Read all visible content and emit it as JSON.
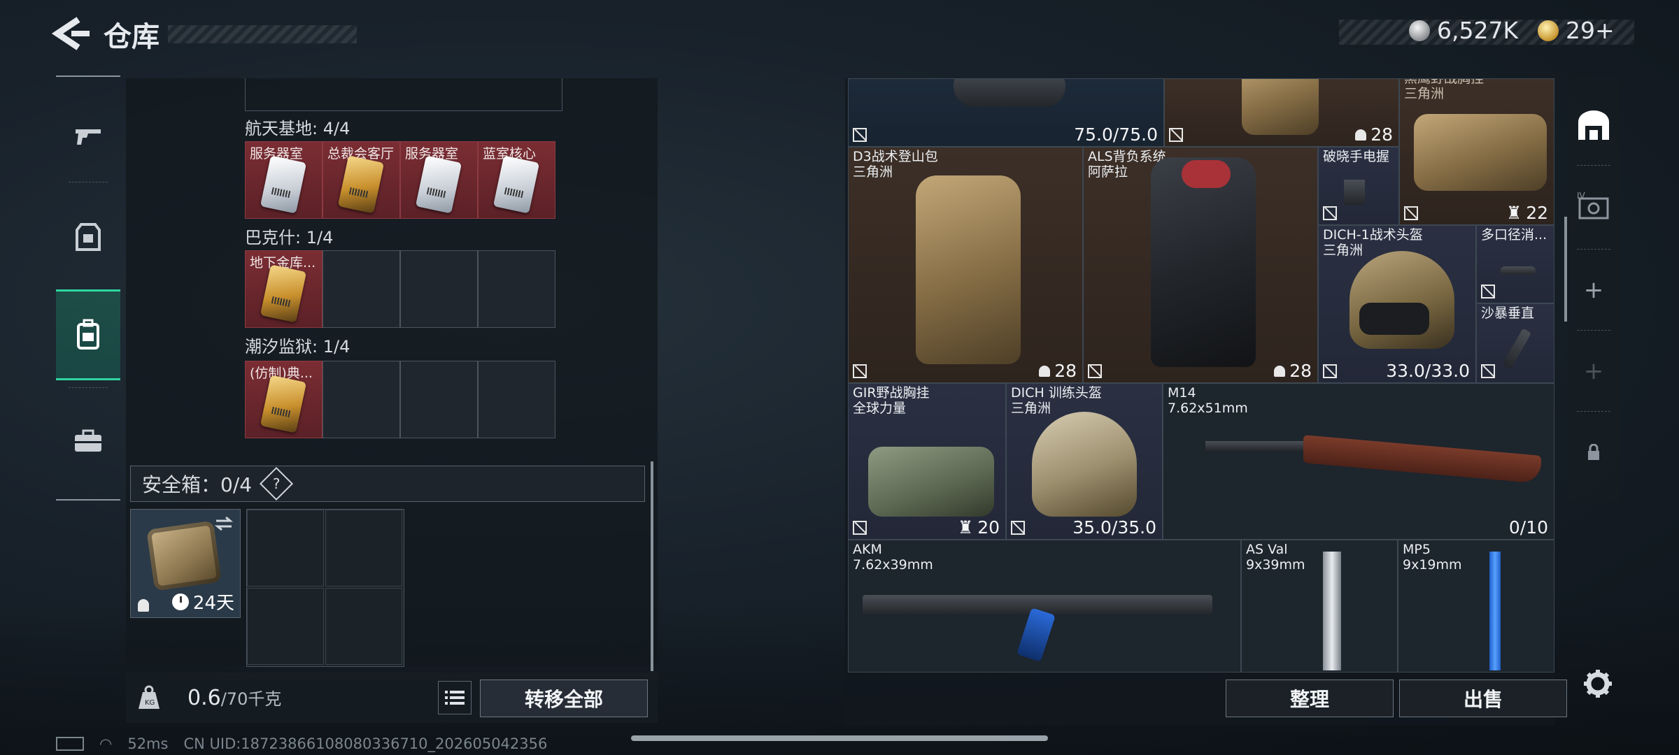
{
  "header": {
    "title": "仓库",
    "back_icon": "chevron-left-icon"
  },
  "currency": {
    "silver": "6,527K",
    "gold": "29+"
  },
  "nav": [
    {
      "name": "weapon",
      "icon": "gun-icon",
      "active": false
    },
    {
      "name": "gear",
      "icon": "armor-icon",
      "active": false
    },
    {
      "name": "bag",
      "icon": "backpack-icon",
      "active": true
    },
    {
      "name": "briefcase",
      "icon": "briefcase-icon",
      "active": false
    }
  ],
  "keys": {
    "sections": [
      {
        "title": "航天基地: 4/4",
        "slots": [
          {
            "label": "服务器室",
            "card": "white"
          },
          {
            "label": "总裁会客厅",
            "card": "gold"
          },
          {
            "label": "服务器室",
            "card": "white"
          },
          {
            "label": "蓝室核心",
            "card": "white"
          }
        ]
      },
      {
        "title": "巴克什: 1/4",
        "slots": [
          {
            "label": "地下金库...",
            "card": "gold"
          },
          {},
          {},
          {}
        ]
      },
      {
        "title": "潮汐监狱: 1/4",
        "slots": [
          {
            "label": "(仿制)典...",
            "card": "gold"
          },
          {},
          {},
          {}
        ]
      }
    ]
  },
  "safe": {
    "label": "安全箱：0/4",
    "help": "?",
    "days": "24天"
  },
  "weight": {
    "current": "0.6",
    "max": "/70千克",
    "transfer_label": "转移全部"
  },
  "status": {
    "ping": "52ms",
    "uid": "CN UID:18723866108080336710_202605042356"
  },
  "items": {
    "top_left_val": "75.0/75.0",
    "top_mid_val": "28",
    "top_right_val": "22",
    "top_right_name": "黑鹰野战胸挂\n三角洲",
    "d3": {
      "name": "D3战术登山包",
      "sub": "三角洲",
      "val": "28"
    },
    "als": {
      "name": "ALS背负系统",
      "sub": "阿萨拉",
      "val": "28"
    },
    "flashlight": {
      "name": "破晓手电握"
    },
    "dich1": {
      "name": "DICH-1战术头盔",
      "sub": "三角洲",
      "val": "33.0/33.0"
    },
    "multi": {
      "name": "多口径消..."
    },
    "sand": {
      "name": "沙暴垂直"
    },
    "gir": {
      "name": "GIR野战胸挂",
      "sub": "全球力量",
      "val": "20"
    },
    "dich": {
      "name": "DICH 训练头盔",
      "sub": "三角洲",
      "val": "35.0/35.0"
    },
    "m14": {
      "name": "M14",
      "sub": "7.62x51mm",
      "val": "0/10"
    },
    "akm": {
      "name": "AKM",
      "sub": "7.62x39mm"
    },
    "asval": {
      "name": "AS Val",
      "sub": "9x39mm"
    },
    "mp5": {
      "name": "MP5",
      "sub": "9x19mm"
    }
  },
  "actions": {
    "sort": "整理",
    "sell": "出售"
  },
  "colors": {
    "accent": "#2fd6a1",
    "red_slot": "#7a2d33"
  }
}
